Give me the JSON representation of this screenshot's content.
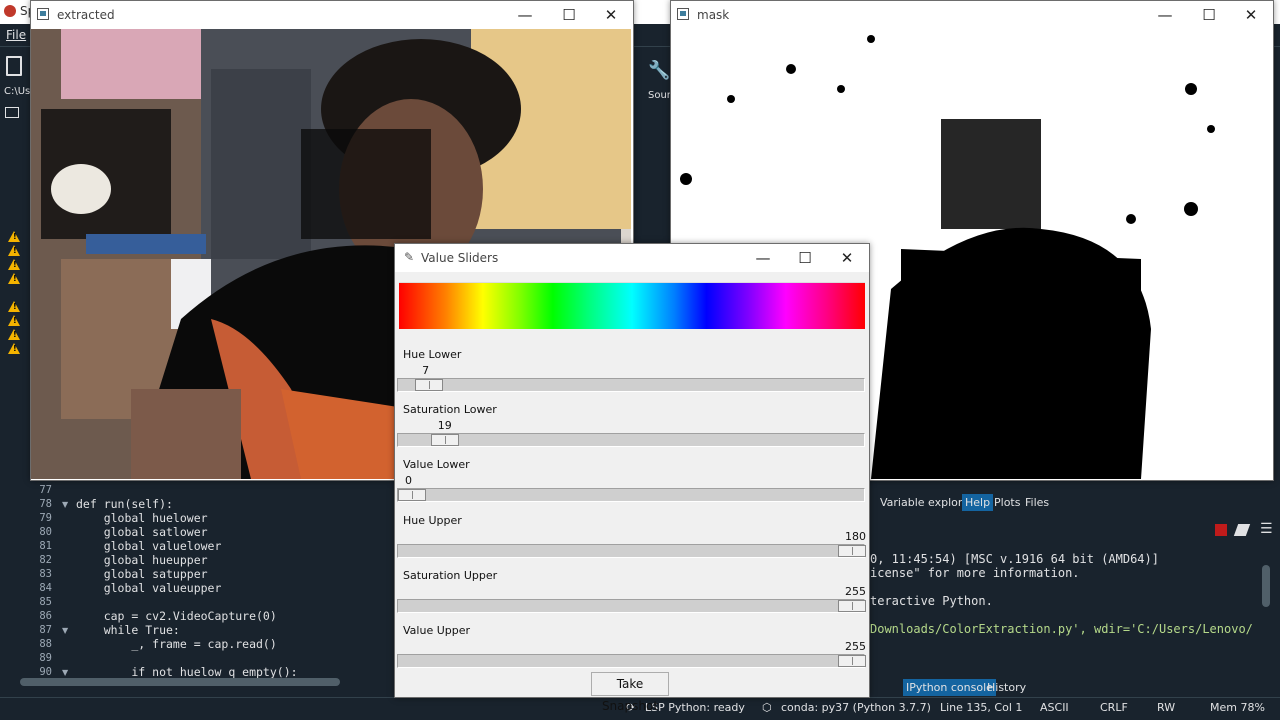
{
  "ide": {
    "title_fragment": "Sp",
    "menu_file": "File",
    "path_fragment": "C:\\Us",
    "source_fragment": "Sour"
  },
  "editor": {
    "lines": [
      {
        "num": "77",
        "text": ""
      },
      {
        "num": "78",
        "text": "def run(self):"
      },
      {
        "num": "79",
        "text": "    global huelower"
      },
      {
        "num": "80",
        "text": "    global satlower"
      },
      {
        "num": "81",
        "text": "    global valuelower"
      },
      {
        "num": "82",
        "text": "    global hueupper"
      },
      {
        "num": "83",
        "text": "    global satupper"
      },
      {
        "num": "84",
        "text": "    global valueupper"
      },
      {
        "num": "85",
        "text": ""
      },
      {
        "num": "86",
        "text": "    cap = cv2.VideoCapture(0)"
      },
      {
        "num": "87",
        "text": "    while True:"
      },
      {
        "num": "88",
        "text": "        _, frame = cap.read()"
      },
      {
        "num": "89",
        "text": ""
      },
      {
        "num": "90",
        "text": "        if not huelow q empty():"
      }
    ]
  },
  "panes": {
    "tabs": [
      "Variable explorer",
      "Help",
      "Plots",
      "Files"
    ],
    "active_tab": "Help",
    "console_lines": [
      "0, 11:45:54) [MSC v.1916 64 bit (AMD64)]",
      "icense\" for more information.",
      "",
      "teractive Python.",
      "",
      "Downloads/ColorExtraction.py', wdir='C:/Users/Lenovo/"
    ],
    "console_tabs": [
      "IPython console",
      "History"
    ],
    "active_console_tab": "IPython console"
  },
  "statusbar": {
    "lsp": "LSP Python: ready",
    "conda": "conda: py37 (Python 3.7.7)",
    "position": "Line 135, Col 1",
    "encoding": "ASCII",
    "eol": "CRLF",
    "mode": "RW",
    "mem": "Mem 78%"
  },
  "windows": {
    "extracted": {
      "title": "extracted"
    },
    "mask": {
      "title": "mask"
    },
    "sliders": {
      "title": "Value Sliders",
      "items": [
        {
          "label": "Hue Lower",
          "value": "7",
          "max": 180
        },
        {
          "label": "Saturation Lower",
          "value": "19",
          "max": 255
        },
        {
          "label": "Value Lower",
          "value": "0",
          "max": 255
        },
        {
          "label": "Hue Upper",
          "value": "180",
          "max": 180
        },
        {
          "label": "Saturation Upper",
          "value": "255",
          "max": 255
        },
        {
          "label": "Value Upper",
          "value": "255",
          "max": 255
        }
      ],
      "snapshot_label": "Take Snapshot"
    },
    "controls": {
      "minimize": "—",
      "maximize": "☐",
      "close": "✕"
    }
  },
  "colors": {
    "ide_bg": "#19232d",
    "accent": "#1464a0",
    "warning": "#f5b400"
  }
}
